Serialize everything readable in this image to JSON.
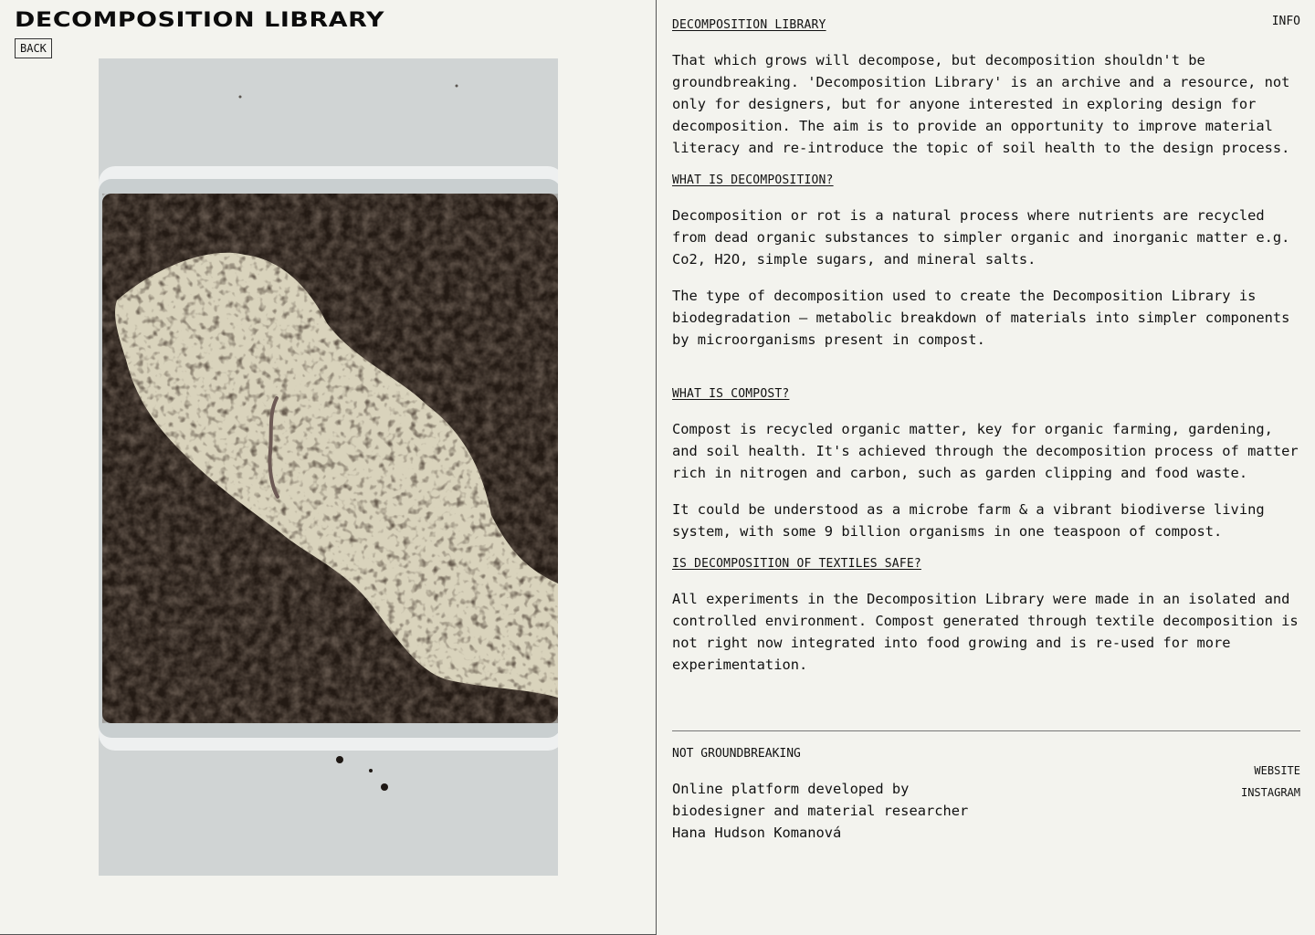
{
  "header": {
    "title": "DECOMPOSITION LIBRARY",
    "back_label": "BACK"
  },
  "nav": {
    "info_label": "INFO"
  },
  "sections": {
    "intro_heading": "DECOMPOSITION LIBRARY",
    "intro_text": "That which grows will decompose, but decomposition shouldn't be groundbreaking. 'Decomposition Library' is an archive and a resource, not only for designers, but for anyone interested in exploring design for decomposition. The aim is to provide an opportunity to improve material literacy and re-introduce the topic of soil health to the design process.",
    "what_is_decomposition_heading": "WHAT IS DECOMPOSITION?",
    "decomposition_text_1": "Decomposition or rot is a natural process where nutrients are recycled from dead organic substances to simpler organic and inorganic matter e.g. Co2, H2O, simple sugars, and mineral salts.",
    "decomposition_text_2": "The type of decomposition used to create the Decomposition Library is biodegradation – metabolic breakdown of materials into simpler components by microorganisms present in compost.",
    "what_is_compost_heading": "WHAT IS COMPOST?",
    "compost_text_1": "Compost is recycled organic matter, key for organic farming, gardening, and soil health. It's achieved through the decomposition process of matter rich in nitrogen and carbon, such as garden clipping and food waste.",
    "compost_text_2": "It could be understood as a microbe farm & a vibrant biodiverse living system, with some 9 billion organisms in one teaspoon of compost.",
    "textiles_heading": "IS DECOMPOSITION OF TEXTILES SAFE?",
    "textiles_text": "All experiments in the Decomposition Library were made in an isolated and controlled environment. Compost generated through textile decomposition is not right now integrated into food growing and is re-used for more experimentation."
  },
  "footer": {
    "title": "NOT GROUNDBREAKING",
    "description_lines": [
      "Online platform developed by",
      "biodesigner and material researcher",
      "Hana Hudson Komanová"
    ],
    "website_label": "WEBSITE",
    "instagram_label": "INSTAGRAM"
  },
  "colors": {
    "background": "#f3f3ee",
    "text": "#111111",
    "soil": "#241a14",
    "textile": "#d8d2bb"
  }
}
